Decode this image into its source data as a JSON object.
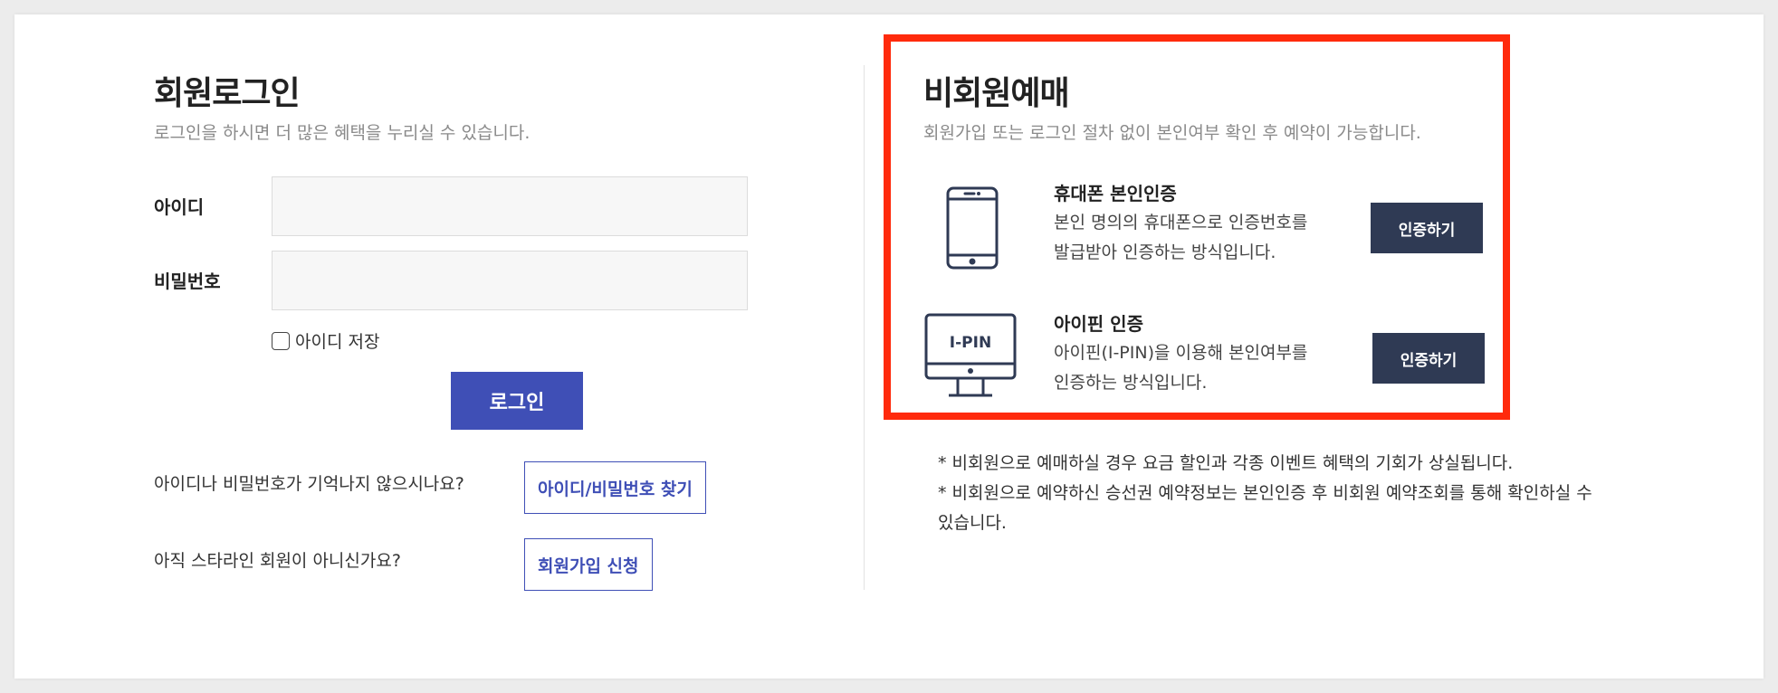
{
  "login": {
    "title": "회원로그인",
    "subtitle": "로그인을 하시면 더 많은 혜택을 누리실 수 있습니다.",
    "id_label": "아이디",
    "id_value": "",
    "pw_label": "비밀번호",
    "pw_value": "",
    "save_id_label": "아이디 저장",
    "save_id_checked": false,
    "login_button": "로그인",
    "forgot_question": "아이디나 비밀번호가 기억나지 않으시나요?",
    "forgot_button": "아이디/비밀번호 찾기",
    "signup_question": "아직 스타라인 회원이 아니신가요?",
    "signup_button": "회원가입 신청"
  },
  "nonmember": {
    "title": "비회원예매",
    "subtitle": "회원가입 또는 로그인 절차 없이 본인여부 확인 후 예약이 가능합니다.",
    "methods": [
      {
        "icon": "smartphone-icon",
        "title": "휴대폰 본인인증",
        "desc_line1": "본인 명의의 휴대폰으로 인증번호를",
        "desc_line2": "발급받아 인증하는 방식입니다.",
        "button": "인증하기"
      },
      {
        "icon": "ipin-monitor-icon",
        "icon_text": "I-PIN",
        "title": "아이핀 인증",
        "desc_line1": "아이핀(I-PIN)을 이용해 본인여부를",
        "desc_line2": "인증하는 방식입니다.",
        "button": "인증하기"
      }
    ],
    "notes": [
      "* 비회원으로 예매하실 경우 요금 할인과 각종 이벤트 혜택의 기회가 상실됩니다.",
      "* 비회원으로 예약하신 승선권 예약정보는 본인인증 후 비회원 예약조회를 통해 확인하실 수",
      "있습니다."
    ]
  },
  "colors": {
    "primary": "#3f4fb6",
    "auth_button": "#2f3a54",
    "highlight_border": "#ff2a0c",
    "icon_stroke": "#2f3a54"
  }
}
